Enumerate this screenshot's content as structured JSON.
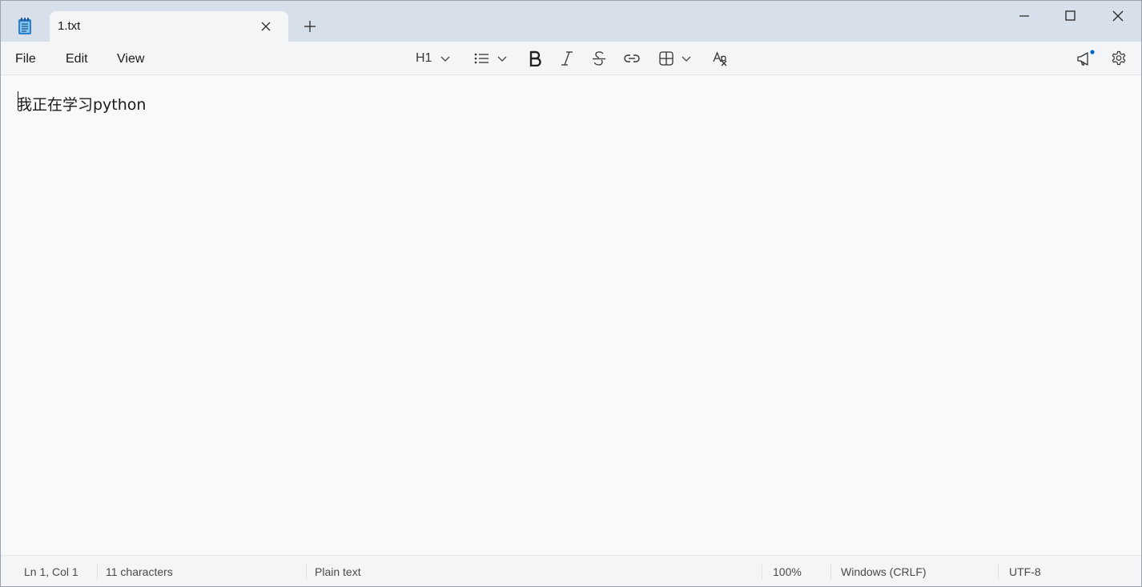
{
  "tab": {
    "title": "1.txt"
  },
  "menu": {
    "file": "File",
    "edit": "Edit",
    "view": "View"
  },
  "toolbar": {
    "heading_label": "H1",
    "icons": [
      "heading-dropdown",
      "list-icon",
      "bold-icon",
      "italic-icon",
      "strikethrough-icon",
      "link-icon",
      "table-icon",
      "clear-formatting-icon",
      "megaphone-icon",
      "gear-icon"
    ]
  },
  "editor": {
    "content": "我正在学习python"
  },
  "status": {
    "position": "Ln 1, Col 1",
    "characters": "11 characters",
    "format": "Plain text",
    "zoom": "100%",
    "line_ending": "Windows (CRLF)",
    "encoding": "UTF-8"
  },
  "colors": {
    "titlebar": "#d7e0ea",
    "tab": "#f3f5f7",
    "editor": "#f9f9f9",
    "notification_dot": "#0067c0"
  }
}
